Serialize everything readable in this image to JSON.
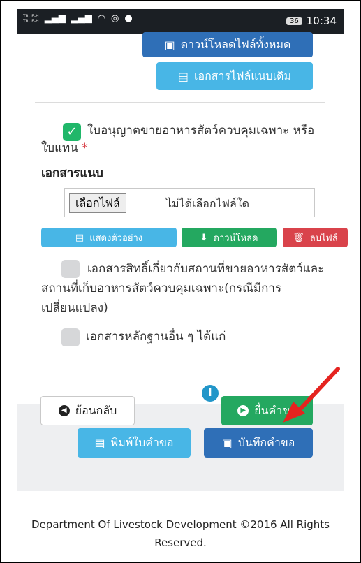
{
  "statusbar": {
    "carrier1": "TRUE-H",
    "carrier2": "TRUE-H",
    "battery": "36",
    "time": "10:34"
  },
  "top_buttons": {
    "download_all": "ดาวน์โหลดไฟล์ทั้งหมด",
    "original_docs": "เอกสารไฟล์แนบเดิม"
  },
  "license": {
    "label": "ใบอนุญาตขายอาหารสัตว์ควบคุมเฉพาะ หรือใบแทน",
    "required_mark": "*",
    "checked": true
  },
  "attachment": {
    "heading": "เอกสารแนบ",
    "choose_file": "เลือกไฟล์",
    "no_file": "ไม่ได้เลือกไฟล์ใด",
    "preview": "แสดงตัวอย่าง",
    "download": "ดาวน์โหลด",
    "delete": "ลบไฟล์"
  },
  "options": [
    {
      "label": "เอกสารสิทธิ์เกี่ยวกับสถานที่ขายอาหารสัตว์และสถานที่เก็บอาหารสัตว์ควบคุมเฉพาะ(กรณีมีการเปลี่ยนแปลง)",
      "checked": false
    },
    {
      "label": "เอกสารหลักฐานอื่น ๆ ได้แก่",
      "checked": false
    }
  ],
  "actions": {
    "back": "ย้อนกลับ",
    "submit": "ยื่นคำขอ",
    "info_badge": "i",
    "print": "พิมพ์ใบคำขอ",
    "save": "บันทึกคำขอ"
  },
  "footer": {
    "copyright": "Department Of Livestock Development ©2016 All Rights Reserved."
  },
  "colors": {
    "primary": "#2f6fb7",
    "info": "#48b6e6",
    "success": "#24a860",
    "danger": "#d9434b",
    "annotation_arrow": "#e5231f"
  }
}
